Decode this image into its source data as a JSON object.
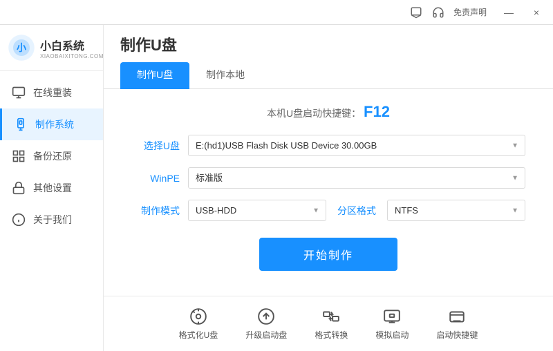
{
  "titlebar": {
    "free_label": "免责声明",
    "minimize_icon": "—",
    "close_icon": "×"
  },
  "sidebar": {
    "logo_main": "小白系统",
    "logo_sub": "XIAOBAIXITONG.COM",
    "nav_items": [
      {
        "id": "online-reinstall",
        "label": "在线重装",
        "icon": "monitor"
      },
      {
        "id": "make-system",
        "label": "制作系统",
        "icon": "usb",
        "active": true
      },
      {
        "id": "backup-restore",
        "label": "备份还原",
        "icon": "grid"
      },
      {
        "id": "other-settings",
        "label": "其他设置",
        "icon": "lock"
      },
      {
        "id": "about-us",
        "label": "关于我们",
        "icon": "info"
      }
    ]
  },
  "page": {
    "title": "制作U盘",
    "tabs": [
      {
        "label": "制作U盘",
        "active": true
      },
      {
        "label": "制作本地",
        "active": false
      }
    ],
    "shortcut_text": "本机U盘启动快捷键：",
    "shortcut_key": "F12",
    "form": {
      "usb_label": "选择U盘",
      "usb_value": "E:(hd1)USB Flash Disk USB Device 30.00GB",
      "winpe_label": "WinPE",
      "winpe_value": "标准版",
      "mode_label": "制作模式",
      "mode_value": "USB-HDD",
      "partition_label": "分区格式",
      "partition_value": "NTFS"
    },
    "start_button": "开始制作"
  },
  "bottom_tools": [
    {
      "id": "format-usb",
      "label": "格式化U盘",
      "icon": "disk"
    },
    {
      "id": "upgrade-boot",
      "label": "升级启动盘",
      "icon": "upload"
    },
    {
      "id": "format-convert",
      "label": "格式转换",
      "icon": "convert"
    },
    {
      "id": "simulate-boot",
      "label": "模拟启动",
      "icon": "screen"
    },
    {
      "id": "boot-shortcut",
      "label": "启动快捷键",
      "icon": "key"
    }
  ]
}
